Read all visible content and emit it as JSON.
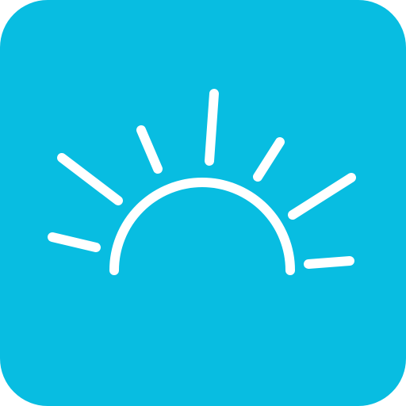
{
  "icon": {
    "name": "sunrise-app-icon",
    "background_color": "#08BDE1",
    "glyph_color": "#FFFFFF",
    "glyph": "sunrise-icon"
  }
}
